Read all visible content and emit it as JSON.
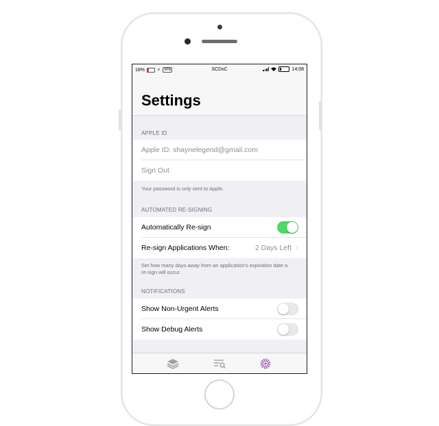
{
  "status_bar": {
    "battery_left": "18%",
    "vpn": "VPN",
    "carrier": "SCDxC",
    "time": "14:08"
  },
  "nav": {
    "title": "Settings"
  },
  "apple_id_section": {
    "header": "APPLE ID",
    "apple_id_placeholder": "Apple ID: shaynelegend@gmail.com",
    "sign_out": "Sign Out",
    "footer": "Your password is only sent to Apple."
  },
  "resign_section": {
    "header": "AUTOMATED RE-SIGNING",
    "auto_resign_label": "Automatically Re-sign",
    "auto_resign_on": true,
    "resign_when_label": "Re-sign Applications When:",
    "resign_when_value": "2 Days Left",
    "footer": "Set how many days away from an application's expiration date a re-sign will occur."
  },
  "notifications_section": {
    "header": "NOTIFICATIONS",
    "non_urgent_label": "Show Non-Urgent Alerts",
    "non_urgent_on": false,
    "debug_label": "Show Debug Alerts",
    "debug_on": false
  },
  "tab_bar": {
    "tabs": [
      {
        "icon": "stack-icon",
        "active": false
      },
      {
        "icon": "list-search-icon",
        "active": false
      },
      {
        "icon": "gear-icon",
        "active": true
      }
    ]
  },
  "colors": {
    "toggle_on": "#4cd964",
    "tab_active": "#8e4fae",
    "tab_inactive": "#a0a0a5"
  }
}
